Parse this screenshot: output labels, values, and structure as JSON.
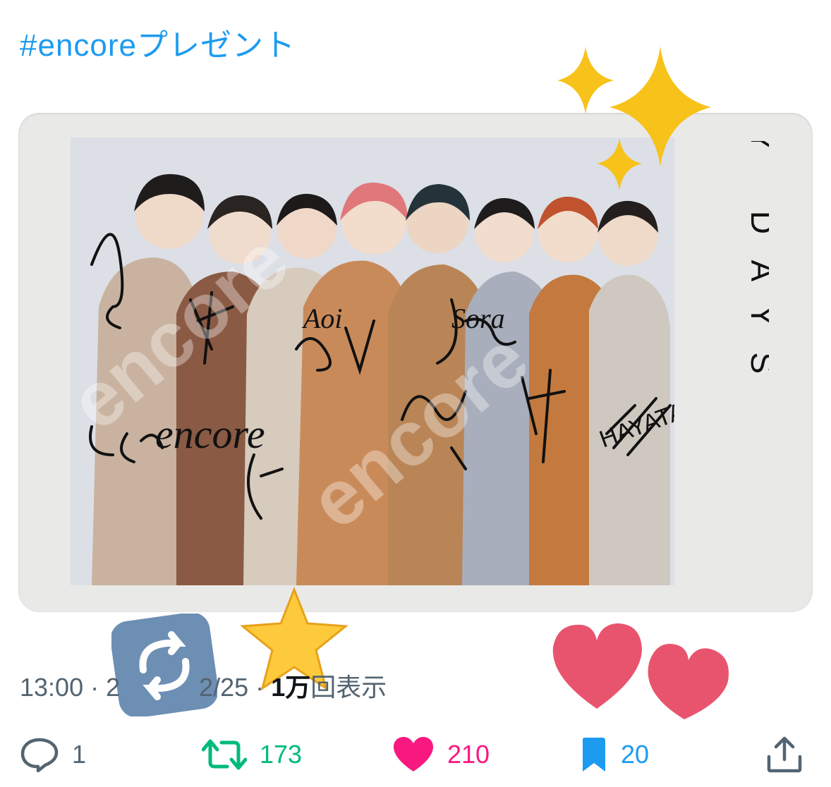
{
  "tweet": {
    "hashtag": "#encoreプレゼント",
    "time": "13:00 · 2",
    "date_fragment": "2/25 ·",
    "views_number": "1万",
    "views_label": "回表示"
  },
  "photo": {
    "side_caption": "VOKSY DAYS",
    "watermark": "encore",
    "signatures": [
      "encore",
      "Aoi",
      "Sora",
      "HAYATA"
    ]
  },
  "actions": {
    "reply_count": "1",
    "retweet_count": "173",
    "like_count": "210",
    "bookmark_count": "20"
  },
  "colors": {
    "link": "#1d9bf0",
    "retweet": "#00ba7c",
    "like": "#f91880",
    "bookmark": "#1d9bf0",
    "muted": "#536471"
  },
  "icons": {
    "reply": "reply-icon",
    "retweet": "retweet-icon",
    "like": "heart-icon",
    "bookmark": "bookmark-icon",
    "share": "share-icon"
  }
}
